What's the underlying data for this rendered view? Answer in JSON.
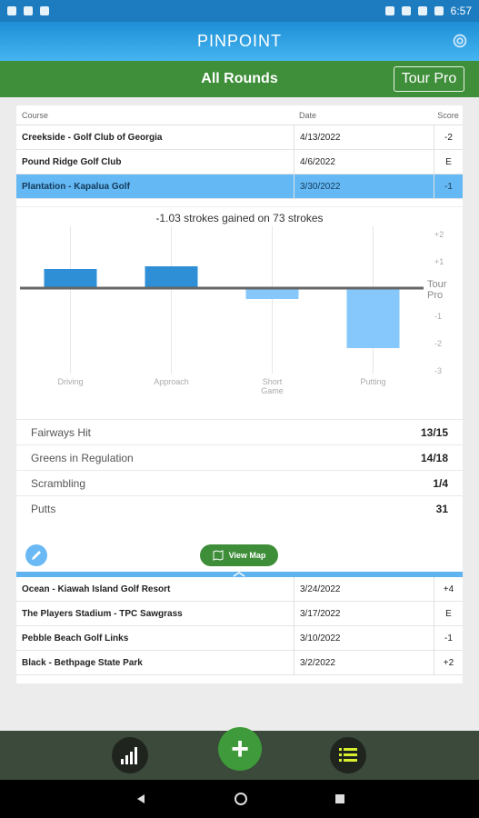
{
  "status": {
    "time": "6:57"
  },
  "app": {
    "logo": "PINPOINT",
    "title": "All Rounds",
    "tour_pro_button": "Tour Pro"
  },
  "table": {
    "headers": {
      "course": "Course",
      "date": "Date",
      "score": "Score"
    },
    "rows_top": [
      {
        "course": "Creekside - Golf Club of Georgia",
        "date": "4/13/2022",
        "score": "-2"
      },
      {
        "course": "Pound Ridge Golf Club",
        "date": "4/6/2022",
        "score": "E"
      },
      {
        "course": "Plantation - Kapalua Golf",
        "date": "3/30/2022",
        "score": "-1",
        "selected": true
      }
    ],
    "rows_bottom": [
      {
        "course": "Ocean - Kiawah Island Golf Resort",
        "date": "3/24/2022",
        "score": "+4"
      },
      {
        "course": "The Players Stadium - TPC Sawgrass",
        "date": "3/17/2022",
        "score": "E"
      },
      {
        "course": "Pebble Beach Golf Links",
        "date": "3/10/2022",
        "score": "-1"
      },
      {
        "course": "Black - Bethpage State Park",
        "date": "3/2/2022",
        "score": "+2"
      }
    ]
  },
  "detail": {
    "summary": "-1.03 strokes gained on 73 strokes",
    "stats": [
      {
        "label": "Fairways Hit",
        "value": "13/15"
      },
      {
        "label": "Greens in Regulation",
        "value": "14/18"
      },
      {
        "label": "Scrambling",
        "value": "1/4"
      },
      {
        "label": "Putts",
        "value": "31"
      }
    ],
    "view_map_label": "View Map"
  },
  "chart_data": {
    "type": "bar",
    "categories": [
      "Driving",
      "Approach",
      "Short Game",
      "Putting"
    ],
    "values": [
      0.7,
      0.8,
      -0.4,
      -2.2
    ],
    "baseline_label": "Tour Pro",
    "ylim": [
      -3,
      2
    ],
    "yticks": [
      "+2",
      "+1",
      "-1",
      "-2",
      "-3"
    ],
    "colors": {
      "positive": "#2f8fd6",
      "negative": "#86c8fb",
      "baseline": "#666666"
    }
  }
}
